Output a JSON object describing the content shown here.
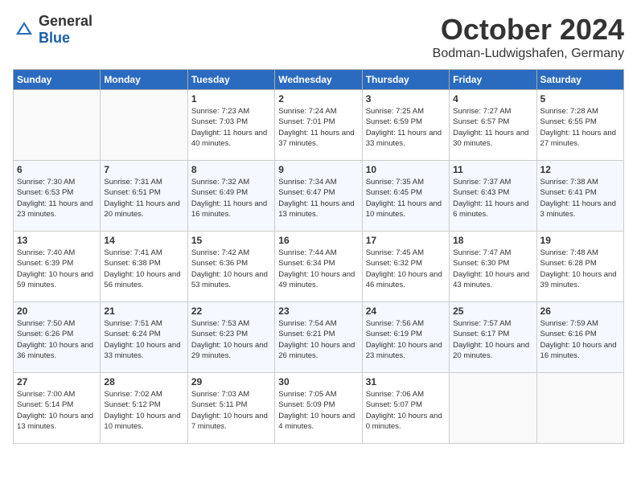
{
  "logo": {
    "general": "General",
    "blue": "Blue"
  },
  "header": {
    "month": "October 2024",
    "location": "Bodman-Ludwigshafen, Germany"
  },
  "weekdays": [
    "Sunday",
    "Monday",
    "Tuesday",
    "Wednesday",
    "Thursday",
    "Friday",
    "Saturday"
  ],
  "weeks": [
    [
      {
        "day": "",
        "content": ""
      },
      {
        "day": "",
        "content": ""
      },
      {
        "day": "1",
        "content": "Sunrise: 7:23 AM\nSunset: 7:03 PM\nDaylight: 11 hours and 40 minutes."
      },
      {
        "day": "2",
        "content": "Sunrise: 7:24 AM\nSunset: 7:01 PM\nDaylight: 11 hours and 37 minutes."
      },
      {
        "day": "3",
        "content": "Sunrise: 7:25 AM\nSunset: 6:59 PM\nDaylight: 11 hours and 33 minutes."
      },
      {
        "day": "4",
        "content": "Sunrise: 7:27 AM\nSunset: 6:57 PM\nDaylight: 11 hours and 30 minutes."
      },
      {
        "day": "5",
        "content": "Sunrise: 7:28 AM\nSunset: 6:55 PM\nDaylight: 11 hours and 27 minutes."
      }
    ],
    [
      {
        "day": "6",
        "content": "Sunrise: 7:30 AM\nSunset: 6:53 PM\nDaylight: 11 hours and 23 minutes."
      },
      {
        "day": "7",
        "content": "Sunrise: 7:31 AM\nSunset: 6:51 PM\nDaylight: 11 hours and 20 minutes."
      },
      {
        "day": "8",
        "content": "Sunrise: 7:32 AM\nSunset: 6:49 PM\nDaylight: 11 hours and 16 minutes."
      },
      {
        "day": "9",
        "content": "Sunrise: 7:34 AM\nSunset: 6:47 PM\nDaylight: 11 hours and 13 minutes."
      },
      {
        "day": "10",
        "content": "Sunrise: 7:35 AM\nSunset: 6:45 PM\nDaylight: 11 hours and 10 minutes."
      },
      {
        "day": "11",
        "content": "Sunrise: 7:37 AM\nSunset: 6:43 PM\nDaylight: 11 hours and 6 minutes."
      },
      {
        "day": "12",
        "content": "Sunrise: 7:38 AM\nSunset: 6:41 PM\nDaylight: 11 hours and 3 minutes."
      }
    ],
    [
      {
        "day": "13",
        "content": "Sunrise: 7:40 AM\nSunset: 6:39 PM\nDaylight: 10 hours and 59 minutes."
      },
      {
        "day": "14",
        "content": "Sunrise: 7:41 AM\nSunset: 6:38 PM\nDaylight: 10 hours and 56 minutes."
      },
      {
        "day": "15",
        "content": "Sunrise: 7:42 AM\nSunset: 6:36 PM\nDaylight: 10 hours and 53 minutes."
      },
      {
        "day": "16",
        "content": "Sunrise: 7:44 AM\nSunset: 6:34 PM\nDaylight: 10 hours and 49 minutes."
      },
      {
        "day": "17",
        "content": "Sunrise: 7:45 AM\nSunset: 6:32 PM\nDaylight: 10 hours and 46 minutes."
      },
      {
        "day": "18",
        "content": "Sunrise: 7:47 AM\nSunset: 6:30 PM\nDaylight: 10 hours and 43 minutes."
      },
      {
        "day": "19",
        "content": "Sunrise: 7:48 AM\nSunset: 6:28 PM\nDaylight: 10 hours and 39 minutes."
      }
    ],
    [
      {
        "day": "20",
        "content": "Sunrise: 7:50 AM\nSunset: 6:26 PM\nDaylight: 10 hours and 36 minutes."
      },
      {
        "day": "21",
        "content": "Sunrise: 7:51 AM\nSunset: 6:24 PM\nDaylight: 10 hours and 33 minutes."
      },
      {
        "day": "22",
        "content": "Sunrise: 7:53 AM\nSunset: 6:23 PM\nDaylight: 10 hours and 29 minutes."
      },
      {
        "day": "23",
        "content": "Sunrise: 7:54 AM\nSunset: 6:21 PM\nDaylight: 10 hours and 26 minutes."
      },
      {
        "day": "24",
        "content": "Sunrise: 7:56 AM\nSunset: 6:19 PM\nDaylight: 10 hours and 23 minutes."
      },
      {
        "day": "25",
        "content": "Sunrise: 7:57 AM\nSunset: 6:17 PM\nDaylight: 10 hours and 20 minutes."
      },
      {
        "day": "26",
        "content": "Sunrise: 7:59 AM\nSunset: 6:16 PM\nDaylight: 10 hours and 16 minutes."
      }
    ],
    [
      {
        "day": "27",
        "content": "Sunrise: 7:00 AM\nSunset: 5:14 PM\nDaylight: 10 hours and 13 minutes."
      },
      {
        "day": "28",
        "content": "Sunrise: 7:02 AM\nSunset: 5:12 PM\nDaylight: 10 hours and 10 minutes."
      },
      {
        "day": "29",
        "content": "Sunrise: 7:03 AM\nSunset: 5:11 PM\nDaylight: 10 hours and 7 minutes."
      },
      {
        "day": "30",
        "content": "Sunrise: 7:05 AM\nSunset: 5:09 PM\nDaylight: 10 hours and 4 minutes."
      },
      {
        "day": "31",
        "content": "Sunrise: 7:06 AM\nSunset: 5:07 PM\nDaylight: 10 hours and 0 minutes."
      },
      {
        "day": "",
        "content": ""
      },
      {
        "day": "",
        "content": ""
      }
    ]
  ]
}
